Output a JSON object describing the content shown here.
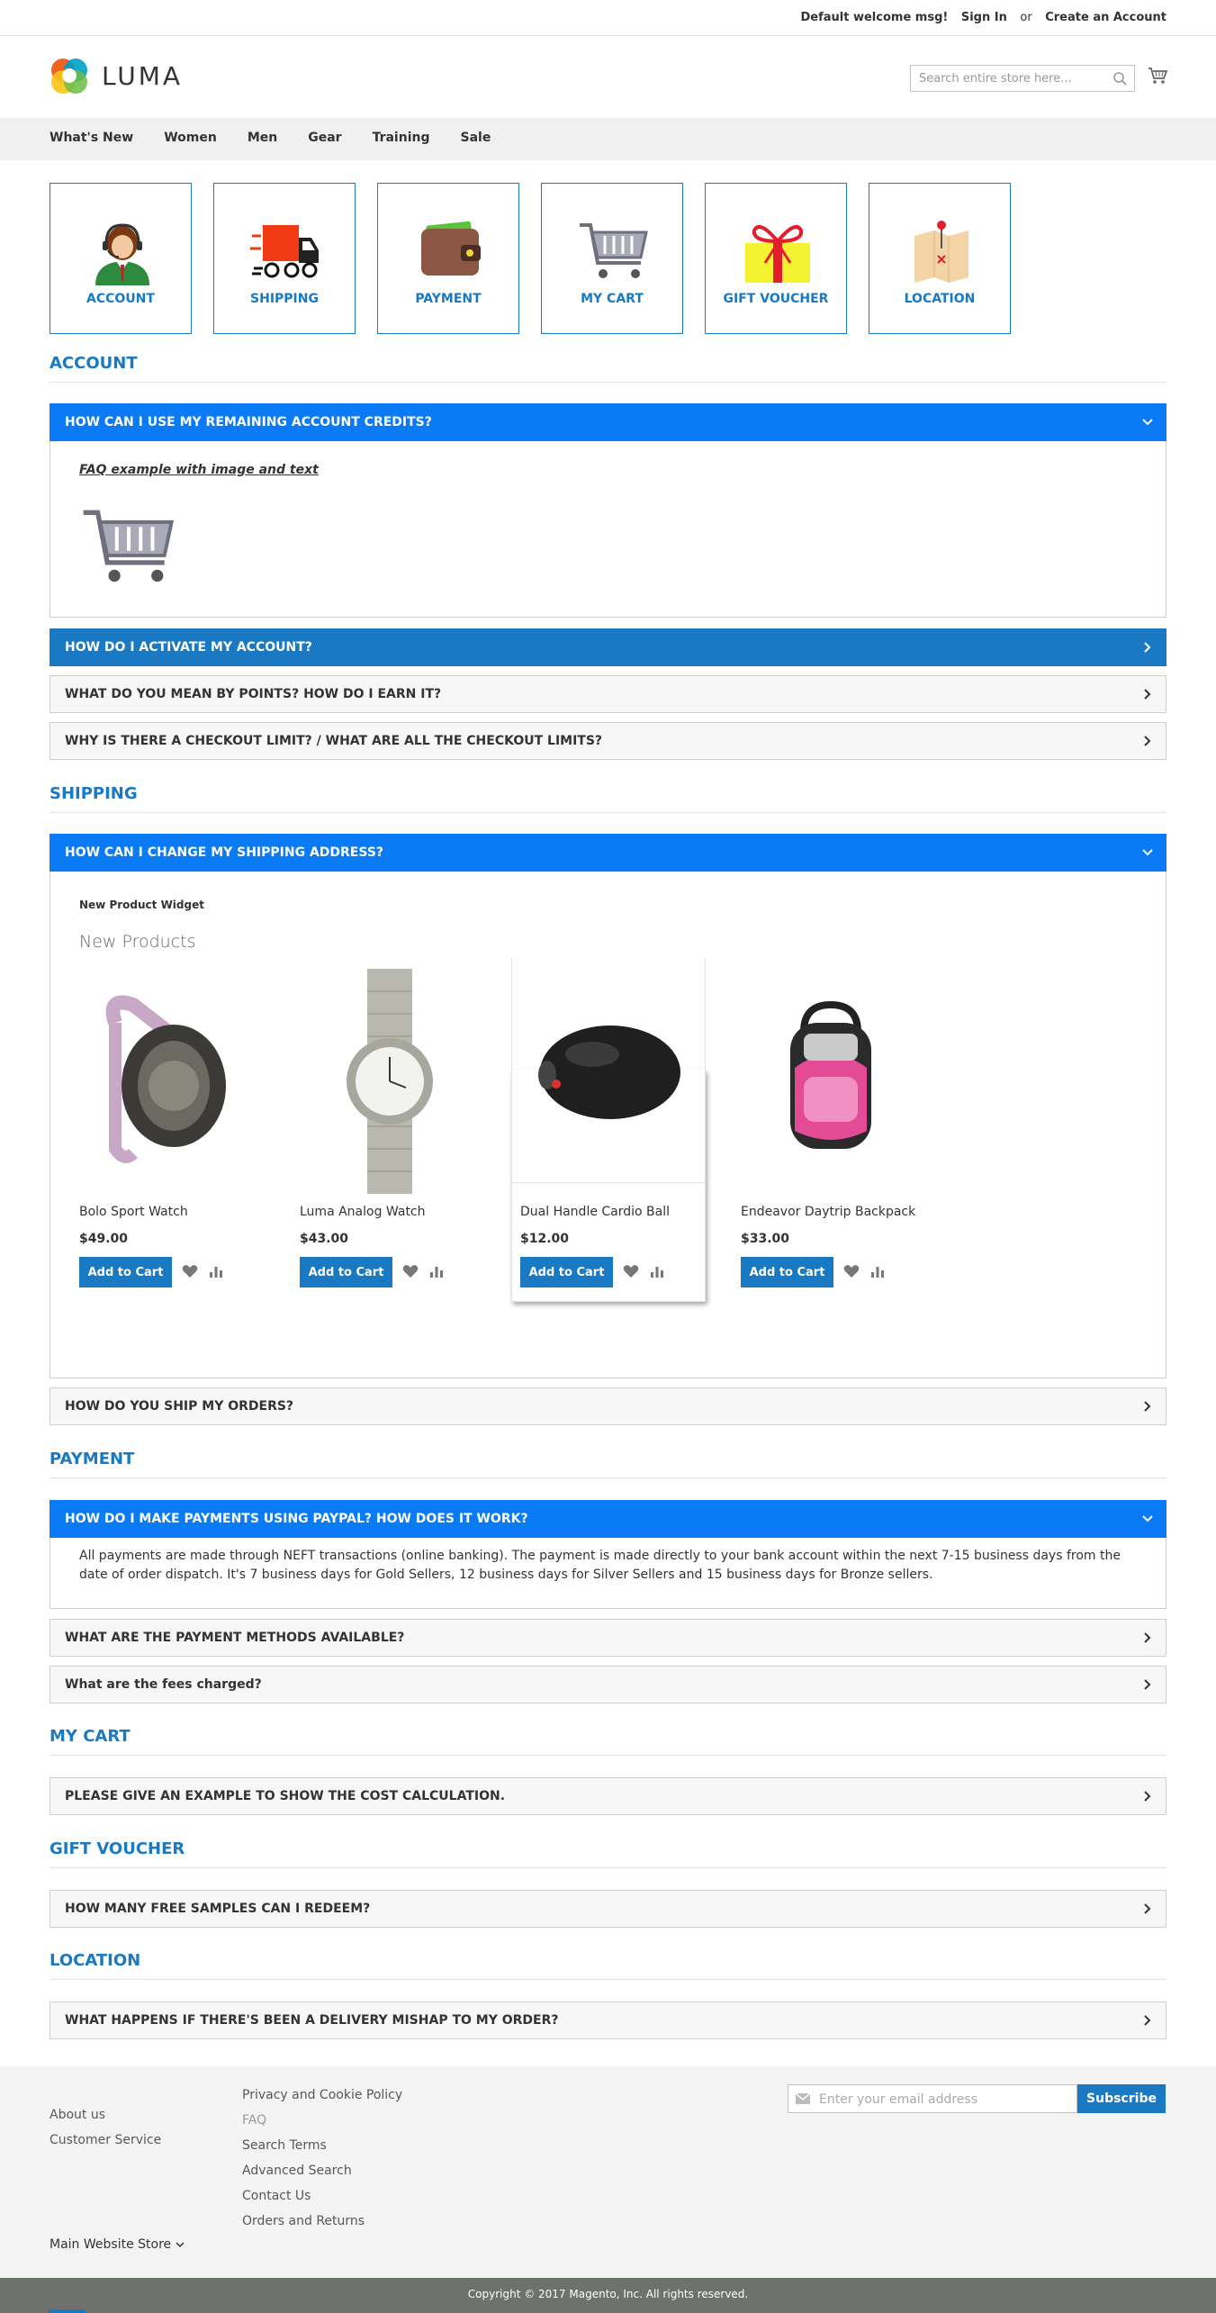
{
  "topbar": {
    "welcome": "Default welcome msg!",
    "sign_in": "Sign In",
    "or": "or",
    "create_account": "Create an Account"
  },
  "header": {
    "logo_text": "LUMA",
    "search_placeholder": "Search entire store here..."
  },
  "nav": {
    "items": [
      "What's New",
      "Women",
      "Men",
      "Gear",
      "Training",
      "Sale"
    ]
  },
  "categories": [
    {
      "label": "ACCOUNT",
      "icon": "support-agent-icon"
    },
    {
      "label": "SHIPPING",
      "icon": "delivery-truck-icon"
    },
    {
      "label": "PAYMENT",
      "icon": "wallet-icon"
    },
    {
      "label": "MY CART",
      "icon": "shopping-cart-icon"
    },
    {
      "label": "GIFT VOUCHER",
      "icon": "gift-box-icon"
    },
    {
      "label": "LOCATION",
      "icon": "map-pin-icon"
    }
  ],
  "sections": {
    "account": {
      "title": "ACCOUNT",
      "q1": "HOW CAN I USE MY REMAINING ACCOUNT CREDITS?",
      "q1_link": "FAQ example with image and text",
      "q2": "HOW DO I ACTIVATE MY ACCOUNT?",
      "q3": "WHAT DO YOU MEAN BY POINTS? HOW DO I EARN IT?",
      "q4": "WHY IS THERE A CHECKOUT LIMIT? / WHAT ARE ALL THE CHECKOUT LIMITS?"
    },
    "shipping": {
      "title": "SHIPPING",
      "q1": "HOW CAN I CHANGE MY SHIPPING ADDRESS?",
      "widget_title": "New Product Widget",
      "widget_heading": "New Products",
      "products": [
        {
          "name": "Bolo Sport Watch",
          "price": "$49.00",
          "button": "Add to Cart"
        },
        {
          "name": "Luma Analog Watch",
          "price": "$43.00",
          "button": "Add to Cart"
        },
        {
          "name": "Dual Handle Cardio Ball",
          "price": "$12.00",
          "button": "Add to Cart"
        },
        {
          "name": "Endeavor Daytrip Backpack",
          "price": "$33.00",
          "button": "Add to Cart"
        }
      ],
      "q2": "HOW DO YOU SHIP MY ORDERS?"
    },
    "payment": {
      "title": "PAYMENT",
      "q1": "HOW DO I MAKE PAYMENTS USING PAYPAL? HOW DOES IT WORK?",
      "q1_answer": "All payments are made through NEFT transactions (online banking). The payment is made directly to your bank account within the next 7-15 business days from the date of order dispatch. It's 7 business days for Gold Sellers, 12 business days for Silver Sellers and 15 business days for Bronze sellers.",
      "q2": "WHAT ARE THE PAYMENT METHODS AVAILABLE?",
      "q3": "What are the fees charged?"
    },
    "mycart": {
      "title": "MY CART",
      "q1": "PLEASE GIVE AN EXAMPLE TO SHOW THE COST CALCULATION."
    },
    "gift": {
      "title": "GIFT VOUCHER",
      "q1": "HOW MANY FREE SAMPLES CAN I REDEEM?"
    },
    "location": {
      "title": "LOCATION",
      "q1": "WHAT HAPPENS IF THERE'S BEEN A DELIVERY MISHAP TO MY ORDER?"
    }
  },
  "footer": {
    "col1": [
      "About us",
      "Customer Service"
    ],
    "col2": [
      "Privacy and Cookie Policy",
      "FAQ",
      "Search Terms",
      "Advanced Search",
      "Contact Us",
      "Orders and Returns"
    ],
    "newsletter_placeholder": "Enter your email address",
    "subscribe": "Subscribe",
    "store_switcher": "Main Website Store",
    "copyright": "Copyright © 2017 Magento, Inc. All rights reserved."
  },
  "colors": {
    "accent": "#1979c3",
    "open_header": "#0a7bf5",
    "nav_bg": "#f0f0f0",
    "footer_bg": "#f4f4f4",
    "copyright_bg": "#6e716e"
  }
}
